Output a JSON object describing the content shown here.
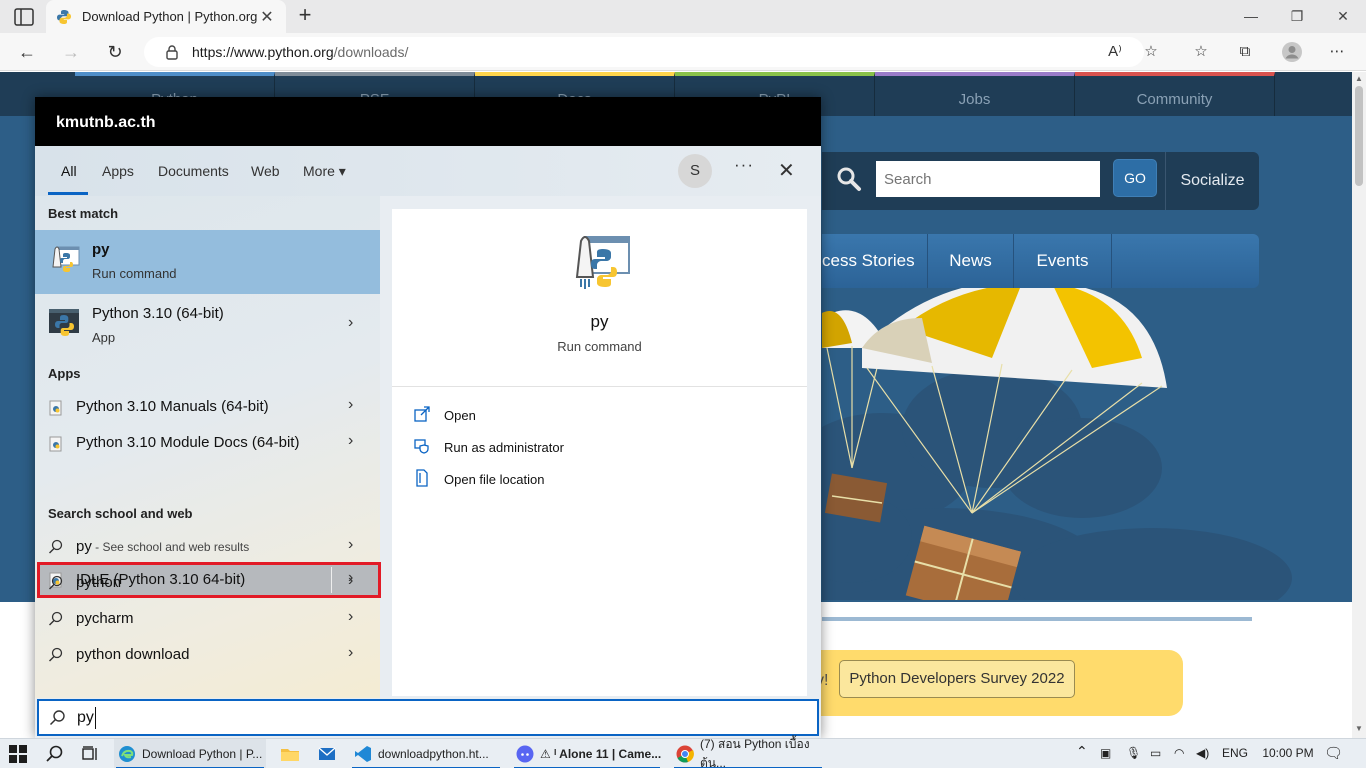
{
  "browser": {
    "tab_title": "Download Python | Python.org",
    "url_host": "https://www.python.org",
    "url_path": "/downloads/",
    "read_aloud_label": "A⁾"
  },
  "site": {
    "nav": [
      {
        "label": "Python",
        "color": "#4f8ec8"
      },
      {
        "label": "PSF",
        "color": "#7f8c98"
      },
      {
        "label": "Docs",
        "color": "#ffd54c"
      },
      {
        "label": "PyPI",
        "color": "#8ac24a"
      },
      {
        "label": "Jobs",
        "color": "#9a7cc9"
      },
      {
        "label": "Community",
        "color": "#d9534f"
      }
    ],
    "search_placeholder": "Search",
    "go_label": "GO",
    "socialize_label": "Socialize",
    "subnav": [
      "cess Stories",
      "News",
      "Events"
    ],
    "survey_fragment": "y!",
    "survey_button": "Python Developers Survey 2022"
  },
  "search_panel": {
    "header": "kmutnb.ac.th",
    "tabs": [
      "All",
      "Apps",
      "Documents",
      "Web",
      "More"
    ],
    "more_arrow": "▾",
    "avatar_letter": "S",
    "dots": "···",
    "close": "✕",
    "best_match_label": "Best match",
    "best_match": {
      "title": "py",
      "subtitle": "Run command"
    },
    "python_app": {
      "title": "Python 3.10 (64-bit)",
      "subtitle": "App"
    },
    "apps_label": "Apps",
    "apps": [
      "Python 3.10 Manuals (64-bit)",
      "Python 3.10 Module Docs (64-bit)",
      "IDLE (Python 3.10 64-bit)"
    ],
    "web_label": "Search school and web",
    "web": [
      {
        "query": "py",
        "suffix": " - See school and web results"
      },
      {
        "query": "python",
        "suffix": ""
      },
      {
        "query": "pycharm",
        "suffix": ""
      },
      {
        "query": "python download",
        "suffix": ""
      }
    ],
    "detail": {
      "title": "py",
      "subtitle": "Run command",
      "actions": [
        "Open",
        "Run as administrator",
        "Open file location"
      ]
    },
    "query": "py"
  },
  "taskbar": {
    "apps": [
      "Download Python | P...",
      "downloadpython.ht...",
      "⚠ ᴵ Alone 11 | Came...",
      "(7) สอน Python เบื้องต้น..."
    ],
    "language": "ENG",
    "time": "10:00 PM"
  }
}
